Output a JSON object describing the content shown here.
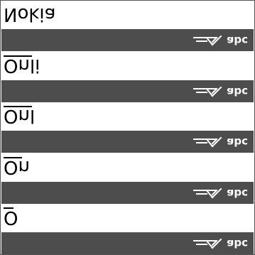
{
  "entries": [
    {
      "text": "Nokia",
      "mode": "abc",
      "mode_icon": "pencil-icon"
    },
    {
      "text": "Onli",
      "mode": "abc",
      "mode_icon": "pencil-icon"
    },
    {
      "text": "Onl",
      "mode": "abc",
      "mode_icon": "pencil-icon"
    },
    {
      "text": "On",
      "mode": "abc",
      "mode_icon": "pencil-icon"
    },
    {
      "text": "O",
      "mode": "abc",
      "mode_icon": "pencil-icon"
    }
  ],
  "colors": {
    "bar": "#4d4d4d",
    "text": "#000000",
    "indicator": "#ffffff"
  }
}
